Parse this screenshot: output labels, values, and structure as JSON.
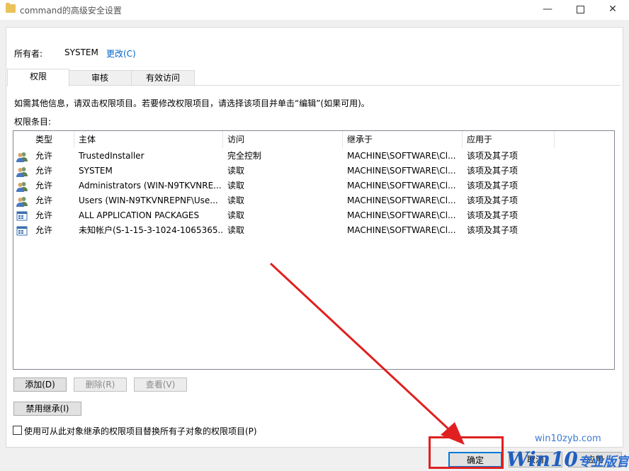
{
  "window": {
    "title": "command的高级安全设置",
    "icon": "folder-icon",
    "min": "—",
    "close": "✕"
  },
  "owner": {
    "label": "所有者:",
    "value": "SYSTEM",
    "change_link": "更改(C)"
  },
  "tabs": [
    {
      "label": "权限",
      "active": true
    },
    {
      "label": "审核",
      "active": false
    },
    {
      "label": "有效访问",
      "active": false
    }
  ],
  "info_text": "如需其他信息，请双击权限项目。若要修改权限项目，请选择该项目并单击“编辑”(如果可用)。",
  "entries_label": "权限条目:",
  "columns": [
    "类型",
    "主体",
    "访问",
    "继承于",
    "应用于"
  ],
  "rows": [
    {
      "icon": "users-icon",
      "type": "允许",
      "principal": "TrustedInstaller",
      "access": "完全控制",
      "inherited": "MACHINE\\SOFTWARE\\Cl...",
      "applies": "该项及其子项"
    },
    {
      "icon": "users-icon",
      "type": "允许",
      "principal": "SYSTEM",
      "access": "读取",
      "inherited": "MACHINE\\SOFTWARE\\Cl...",
      "applies": "该项及其子项"
    },
    {
      "icon": "users-icon",
      "type": "允许",
      "principal": "Administrators (WIN-N9TKVNRE...",
      "access": "读取",
      "inherited": "MACHINE\\SOFTWARE\\Cl...",
      "applies": "该项及其子项"
    },
    {
      "icon": "users-icon",
      "type": "允许",
      "principal": "Users (WIN-N9TKVNREPNF\\Use...",
      "access": "读取",
      "inherited": "MACHINE\\SOFTWARE\\Cl...",
      "applies": "该项及其子项"
    },
    {
      "icon": "app-package-icon",
      "type": "允许",
      "principal": "ALL APPLICATION PACKAGES",
      "access": "读取",
      "inherited": "MACHINE\\SOFTWARE\\Cl...",
      "applies": "该项及其子项"
    },
    {
      "icon": "app-package-icon",
      "type": "允许",
      "principal": "未知帐户(S-1-15-3-1024-1065365...",
      "access": "读取",
      "inherited": "MACHINE\\SOFTWARE\\Cl...",
      "applies": "该项及其子项"
    }
  ],
  "buttons": {
    "add": "添加(D)",
    "remove": "删除(R)",
    "view": "查看(V)",
    "disable_inheritance": "禁用继承(I)",
    "ok": "确定",
    "cancel": "取消",
    "apply": "应用"
  },
  "replace_checkbox": {
    "label": "使用可从此对象继承的权限项目替换所有子对象的权限项目(P)",
    "checked": false
  },
  "watermark": {
    "url": "win10zyb.com",
    "brand": "Win10",
    "sub": "专业版官网"
  },
  "colors": {
    "accent": "#0078d7",
    "link": "#0066cc",
    "annotation": "#e02020"
  }
}
